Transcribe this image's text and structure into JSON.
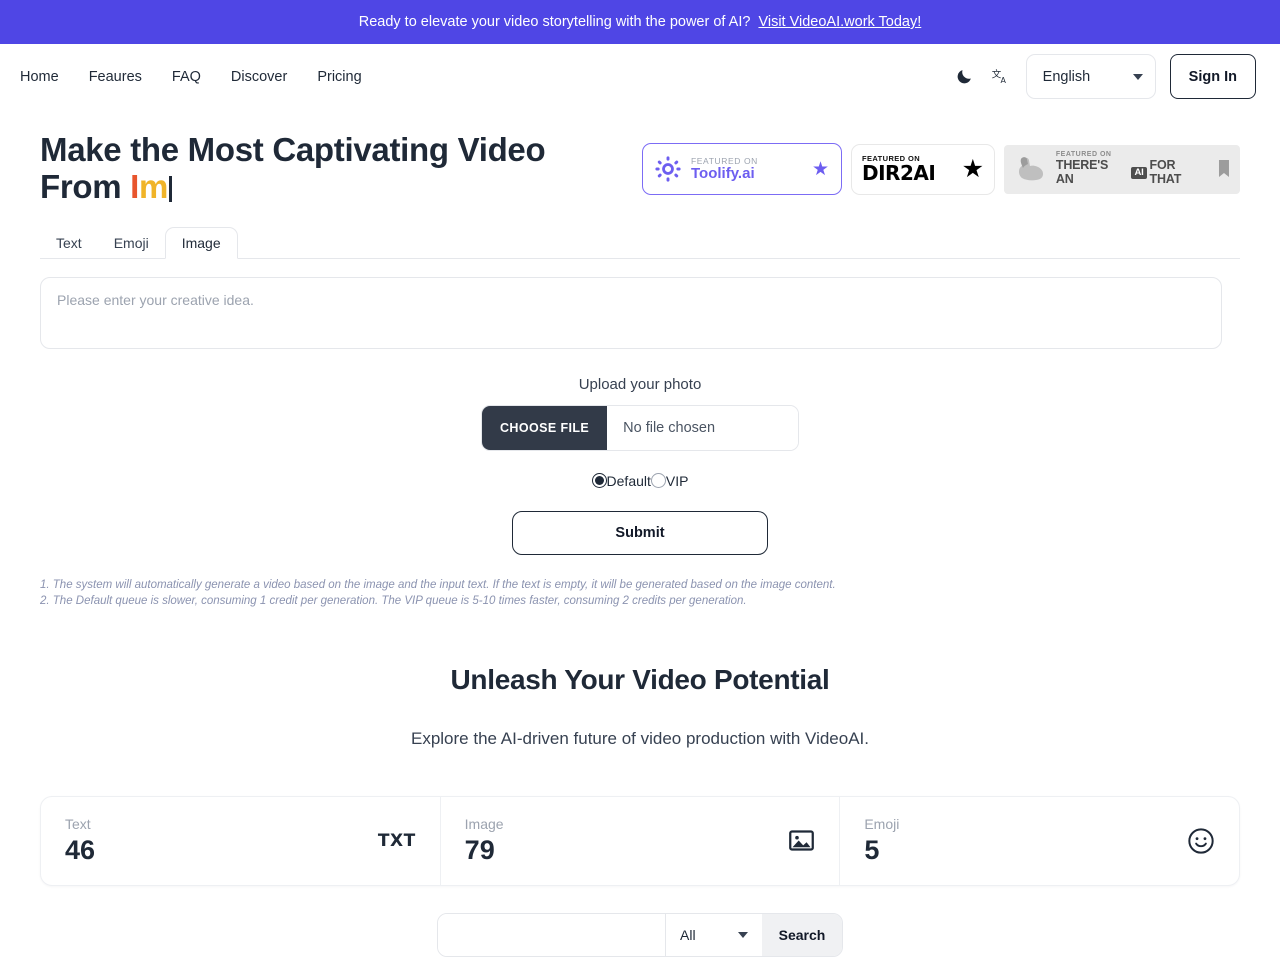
{
  "promo": {
    "text": "Ready to elevate your video storytelling with the power of AI?",
    "link_label": "Visit VideoAI.work Today!",
    "background": "#4f46e5"
  },
  "header": {
    "nav": [
      {
        "label": "Home"
      },
      {
        "label": "Feaures"
      },
      {
        "label": "FAQ"
      },
      {
        "label": "Discover"
      },
      {
        "label": "Pricing"
      }
    ],
    "dark_mode_icon": "moon-icon",
    "translate_icon": "translate-icon",
    "language": {
      "value": "English"
    },
    "sign_in_label": "Sign In"
  },
  "hero": {
    "title_line1": "Make the Most Captivating Video",
    "title_line2_prefix": "From ",
    "typed_char_1": "I",
    "typed_char_2": "m",
    "accent_1": "#e8552d",
    "accent_2": "#f0b429",
    "badges": [
      {
        "featured_label": "FEATURED ON",
        "name": "Toolify.ai",
        "icon": "toolify-logo-icon",
        "star": "★",
        "accent": "#6d5ef0"
      },
      {
        "featured_label": "FEATURED ON",
        "name": "DIR2AI",
        "star": "★",
        "accent": "#000000"
      },
      {
        "featured_label": "FEATURED ON",
        "name_part1": "THERE'S AN",
        "name_badge": "AI",
        "name_part2": "FOR THAT",
        "icon": "flexed-arm-icon",
        "bookmark": "bookmark-icon",
        "accent": "#4d4d4d"
      }
    ]
  },
  "tabs": [
    {
      "label": "Text",
      "active": false
    },
    {
      "label": "Emoji",
      "active": false
    },
    {
      "label": "Image",
      "active": true
    }
  ],
  "form": {
    "idea_placeholder": "Please enter your creative idea.",
    "idea_value": "",
    "upload_label": "Upload your photo",
    "choose_file_label": "CHOOSE FILE",
    "file_status": "No file chosen",
    "queue_options": [
      {
        "label": "Default",
        "selected": true
      },
      {
        "label": "VIP",
        "selected": false
      }
    ],
    "submit_label": "Submit",
    "notes": [
      "1. The system will automatically generate a video based on the image and the input text. If the text is empty, it will be generated based on the image content.",
      "2. The Default queue is slower, consuming 1 credit per generation. The VIP queue is 5-10 times faster, consuming 2 credits per generation."
    ]
  },
  "potential": {
    "title": "Unleash Your Video Potential",
    "subtitle": "Explore the AI-driven future of video production with VideoAI."
  },
  "stats": [
    {
      "label": "Text",
      "value": "46",
      "icon": "txt-icon"
    },
    {
      "label": "Image",
      "value": "79",
      "icon": "picture-icon"
    },
    {
      "label": "Emoji",
      "value": "5",
      "icon": "smiley-icon"
    }
  ],
  "search": {
    "value": "",
    "placeholder": "",
    "scope": "All",
    "button_label": "Search"
  }
}
